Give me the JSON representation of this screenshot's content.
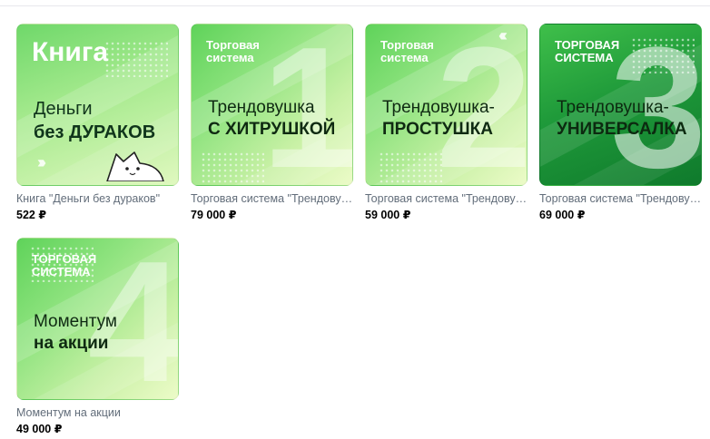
{
  "products": [
    {
      "thumb": {
        "title": "Книга",
        "line1": "Деньги",
        "line2": "без ДУРАКОВ"
      },
      "title": "Книга \"Деньги без дураков\"",
      "price": "522 ₽"
    },
    {
      "thumb": {
        "kicker1": "Торговая",
        "kicker2": "система",
        "line1": "Трендовушка",
        "line2": "С ХИТРУШКОЙ",
        "number": "1"
      },
      "title": "Торговая система \"Трендовушка с хитрушкой\"",
      "price": "79 000 ₽"
    },
    {
      "thumb": {
        "kicker1": "Торговая",
        "kicker2": "система",
        "line1": "Трендовушка-",
        "line2": "ПРОСТУШКА",
        "number": "2"
      },
      "title": "Торговая система \"Трендовушка-простушка\"",
      "price": "59 000 ₽"
    },
    {
      "thumb": {
        "kicker1": "ТОРГОВАЯ",
        "kicker2": "СИСТЕМА",
        "line1": "Трендовушка-",
        "line2": "УНИВЕРСАЛКА",
        "number": "3"
      },
      "title": "Торговая система \"Трендовушка-универсалка\"",
      "price": "69 000 ₽"
    },
    {
      "thumb": {
        "kicker1": "ТОРГОВАЯ",
        "kicker2": "СИСТЕМА",
        "line1": "Моментум",
        "line2": "на акции",
        "number": "4"
      },
      "title": "Моментум на акции",
      "price": "49 000 ₽"
    }
  ]
}
